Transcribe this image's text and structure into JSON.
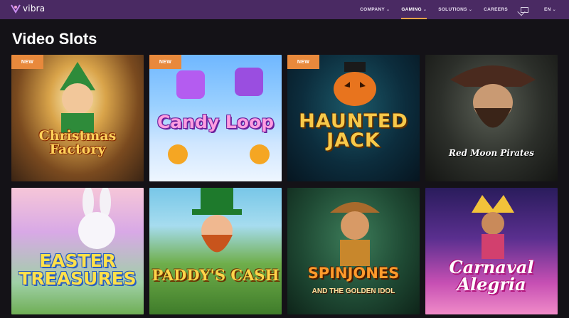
{
  "brand": {
    "name": "vibra"
  },
  "nav": {
    "items": [
      {
        "label": "COMPANY",
        "has_dropdown": true,
        "active": false
      },
      {
        "label": "GAMING",
        "has_dropdown": true,
        "active": true
      },
      {
        "label": "SOLUTIONS",
        "has_dropdown": true,
        "active": false
      },
      {
        "label": "CAREERS",
        "has_dropdown": false,
        "active": false
      }
    ],
    "language": "EN",
    "contact_icon": "mail-icon"
  },
  "page": {
    "section_title": "Video Slots"
  },
  "games": [
    {
      "title": "Christmas Factory",
      "badge": "NEW"
    },
    {
      "title": "Candy Loop",
      "badge": "NEW"
    },
    {
      "title": "HAUNTED JACK",
      "badge": "NEW"
    },
    {
      "title": "Red Moon Pirates",
      "badge": ""
    },
    {
      "title": "EASTER TREASURES",
      "badge": ""
    },
    {
      "title": "PADDY'S CASH",
      "badge": ""
    },
    {
      "title": "SPINJONES",
      "subtitle": "AND THE GOLDEN IDOL",
      "badge": ""
    },
    {
      "title": "Carnaval Alegria",
      "badge": ""
    }
  ],
  "colors": {
    "header_bg": "#4a2a63",
    "page_bg": "#141217",
    "badge_bg": "#e8893c",
    "active_nav_underline": "#e8a34a"
  }
}
